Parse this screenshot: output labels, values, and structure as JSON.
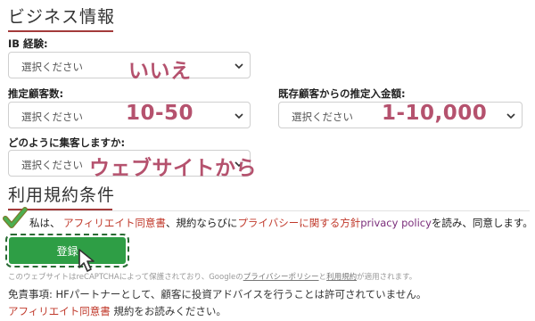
{
  "business": {
    "title": "ビジネス情報",
    "ib_label": "IB 経験:",
    "ib_placeholder": "選択ください",
    "ib_answer": "いいえ",
    "estimated_label": "推定顧客数:",
    "estimated_placeholder": "選択ください",
    "estimated_answer": "10-50",
    "deposit_label": "既存顧客からの推定入金額:",
    "deposit_placeholder": "選択ください",
    "deposit_answer": "1-10,000",
    "acquire_label": "どのように集客しますか:",
    "acquire_placeholder": "選択ください",
    "acquire_answer": "ウェブサイトから"
  },
  "terms": {
    "title": "利用規約条件",
    "consent_prefix": "私は、",
    "affiliate_agreement": "アフィリエイト同意書",
    "mid": "、規約ならびに",
    "privacy_link": "プライバシーに関する方針",
    "privacy_en": "privacy policy",
    "suffix": "を読み、同意します。",
    "register_label": "登録",
    "recaptcha_prefix": "このウェブサイトはreCAPTCHAによって保護されており、Googleの",
    "recaptcha_privacy": "プライバシーポリシー",
    "recaptcha_and": "と",
    "recaptcha_terms": "利用規約",
    "recaptcha_suffix": "が適用されます。",
    "disclaimer": "免責事項: HFパートナーとして、顧客に投資アドバイスを行うことは許可されていません。",
    "affiliate_bottom": "アフィリエイト同意書",
    "bottom_suffix": " 規約をお読みください。"
  },
  "colors": {
    "accent_rule": "#a33b3b",
    "overlay_text": "#b5526e",
    "button_green": "#2e9e45",
    "link_red": "#c0392b"
  },
  "icons": [
    "chevron-down-icon",
    "check-mark-icon",
    "mouse-cursor-icon"
  ]
}
